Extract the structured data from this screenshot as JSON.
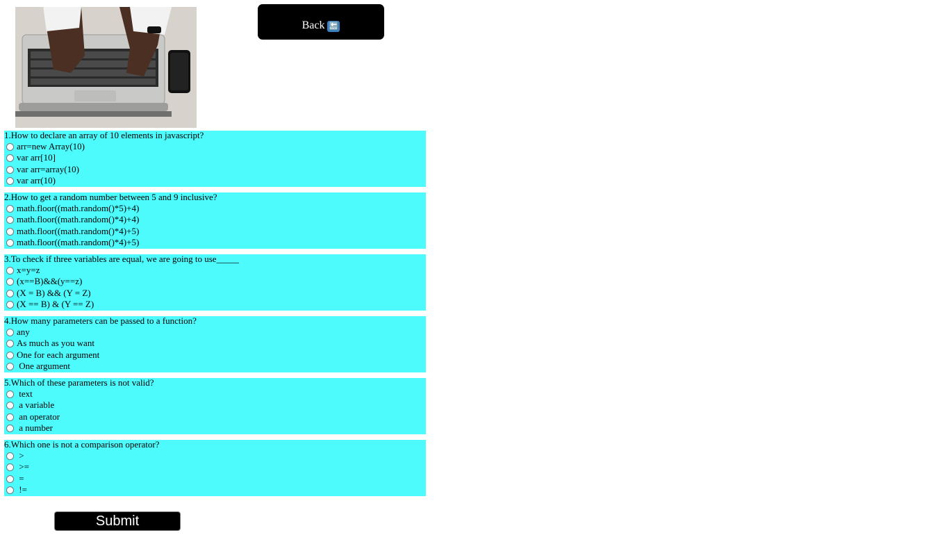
{
  "header": {
    "back_label": "Back",
    "back_icon": "🔙"
  },
  "questions": [
    {
      "text": "1.How to declare an array of 10 elements in javascript?",
      "options": [
        "arr=new Array(10)",
        "var arr[10]",
        "var arr=array(10)",
        "var arr(10)"
      ]
    },
    {
      "text": "2.How to get a random number between 5 and 9 inclusive?",
      "options": [
        "math.floor((math.random()*5)+4)",
        "math.floor((math.random()*4)+4)",
        "math.floor((math.random()*4)+5)",
        "math.floor((math.random()*4)+5)"
      ]
    },
    {
      "text": "3.To check if three variables are equal, we are going to use_____",
      "options": [
        "x=y=z",
        "(x==B)&&(y==z)",
        "(X = B) && (Y = Z)",
        "(X == B) & (Y == Z)"
      ]
    },
    {
      "text": "4.How many parameters can be passed to a function?",
      "options": [
        "any",
        "As much as you want",
        "One for each argument",
        " One argument"
      ]
    },
    {
      "text": "5.Which of these parameters is not valid?",
      "options": [
        " text",
        " a variable",
        " an operator",
        " a number"
      ]
    },
    {
      "text": "6.Which one is not a comparison operator?",
      "options": [
        " >",
        " >=",
        " =",
        " !="
      ]
    }
  ],
  "submit_label": "Submit",
  "colors": {
    "question_bg": "#4dfafc",
    "button_bg": "#000000"
  }
}
